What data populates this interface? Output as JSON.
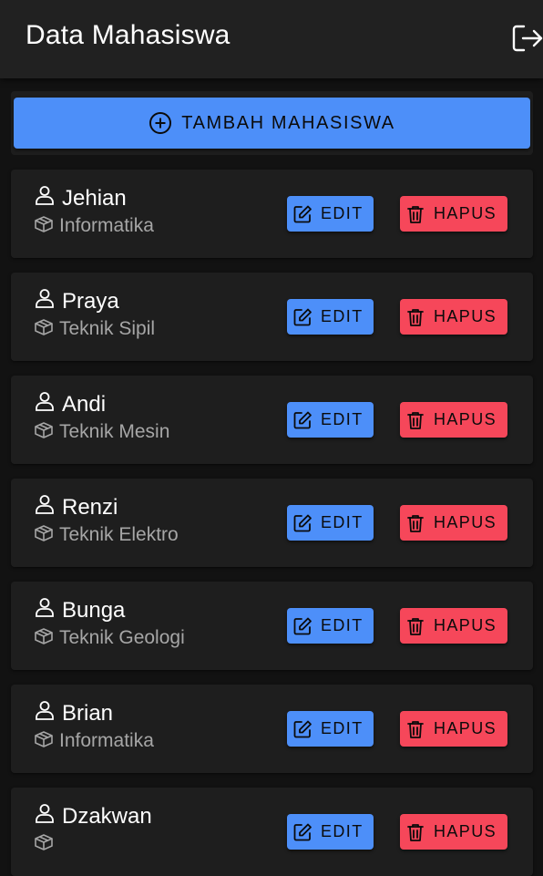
{
  "header": {
    "title": "Data Mahasiswa",
    "logout_icon": "logout-icon"
  },
  "add_button": {
    "label": "TAMBAH MAHASISWA",
    "icon": "plus-circle-icon"
  },
  "buttons": {
    "edit_label": "EDIT",
    "delete_label": "HAPUS"
  },
  "colors": {
    "primary": "#4d8ff9",
    "danger": "#f6475a",
    "background": "#121212",
    "surface": "#1e1e1e",
    "appbar": "#212121"
  },
  "students": [
    {
      "name": "Jehian",
      "major": "Informatika"
    },
    {
      "name": "Praya",
      "major": "Teknik Sipil"
    },
    {
      "name": "Andi",
      "major": "Teknik Mesin"
    },
    {
      "name": "Renzi",
      "major": "Teknik Elektro"
    },
    {
      "name": "Bunga",
      "major": "Teknik Geologi"
    },
    {
      "name": "Brian",
      "major": "Informatika"
    },
    {
      "name": "Dzakwan",
      "major": ""
    }
  ]
}
